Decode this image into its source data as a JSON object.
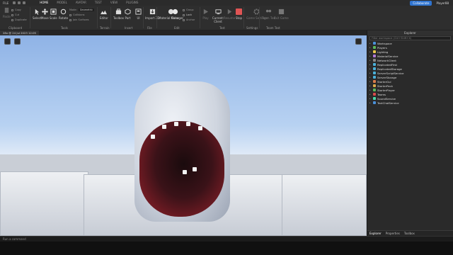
{
  "menubar": {
    "file": "FILE",
    "tabs": [
      "HOME",
      "MODEL",
      "AVATAR",
      "TEST",
      "VIEW",
      "PLUGINS"
    ],
    "active_tab": "HOME",
    "collaborate": "Collaborate",
    "user": "Player88"
  },
  "ribbon": {
    "clipboard": {
      "label": "Clipboard",
      "paste": "Paste",
      "copy": "Copy",
      "cut": "Cut",
      "duplicate": "Duplicate"
    },
    "tools": {
      "label": "Tools",
      "select": "Select",
      "move": "Move",
      "scale": "Scale",
      "rotate": "Rotate",
      "mode": "Mode:",
      "mode_value": "Geometric",
      "collisions": "Collisions",
      "join": "Join Surfaces"
    },
    "terrain": {
      "label": "Terrain",
      "editor": "Editor"
    },
    "insert": {
      "label": "Insert",
      "toolbox": "Toolbox",
      "part": "Part",
      "ui": "UI"
    },
    "file": {
      "label": "File",
      "import3d": "Import 3D"
    },
    "edit": {
      "label": "Edit",
      "material": "Material Manager",
      "color": "Color",
      "group": "Group",
      "lock": "Lock",
      "anchor": "Anchor"
    },
    "test": {
      "label": "Test",
      "play": "Play",
      "client": "Current: Client",
      "resume": "Resume",
      "stop": "Stop"
    },
    "settings": {
      "label": "Settings",
      "game": "Game Settings"
    },
    "team": {
      "label": "Team Test",
      "test": "Team Test",
      "exit": "Exit Game"
    }
  },
  "doc_tab": "28x @ 24 Jul 2023 12:05",
  "explorer": {
    "title": "Explorer",
    "filter_placeholder": "Filter workspace (Ctrl+Shift+X)",
    "items": [
      {
        "label": "Workspace",
        "color": "#4a90d9"
      },
      {
        "label": "Players",
        "color": "#5bb85b"
      },
      {
        "label": "Lighting",
        "color": "#e8c84a"
      },
      {
        "label": "MaterialService",
        "color": "#b07ad9"
      },
      {
        "label": "NetworkClient",
        "color": "#888888"
      },
      {
        "label": "ReplicatedFirst",
        "color": "#4ab0d9"
      },
      {
        "label": "ReplicatedStorage",
        "color": "#4ab0d9"
      },
      {
        "label": "ServerScriptService",
        "color": "#4ab0d9"
      },
      {
        "label": "ServerStorage",
        "color": "#4ab0d9"
      },
      {
        "label": "StarterGui",
        "color": "#d97a4a"
      },
      {
        "label": "StarterPack",
        "color": "#d9a84a"
      },
      {
        "label": "StarterPlayer",
        "color": "#5bb85b"
      },
      {
        "label": "Teams",
        "color": "#d94a4a"
      },
      {
        "label": "SoundService",
        "color": "#4ad9a8"
      },
      {
        "label": "TextChatService",
        "color": "#4a90d9"
      }
    ],
    "tabs": [
      "Explorer",
      "Properties",
      "Toolbox"
    ]
  },
  "command_placeholder": "Run a command"
}
